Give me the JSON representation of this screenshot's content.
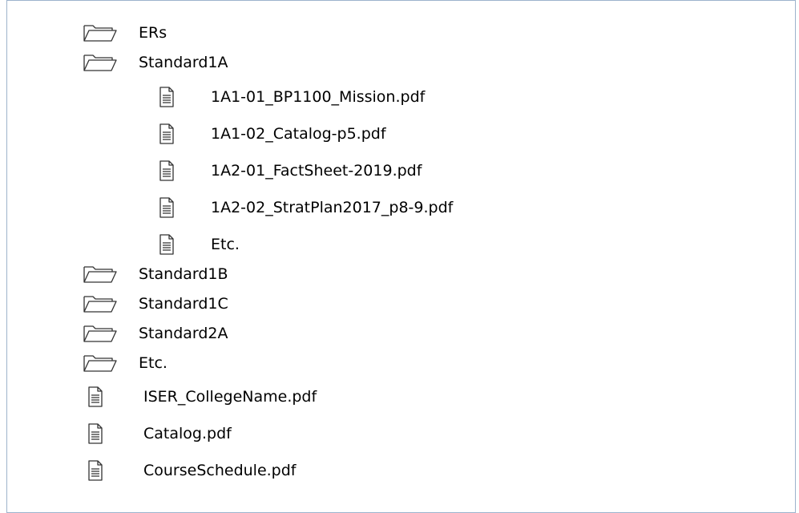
{
  "tree": {
    "items": [
      {
        "type": "folder",
        "level": 0,
        "label": "ERs",
        "icon": "folder-icon"
      },
      {
        "type": "folder",
        "level": 0,
        "label": "Standard1A",
        "icon": "folder-icon"
      },
      {
        "type": "file",
        "level": 1,
        "label": "1A1-01_BP1100_Mission.pdf",
        "icon": "document-icon"
      },
      {
        "type": "file",
        "level": 1,
        "label": "1A1-02_Catalog-p5.pdf",
        "icon": "document-icon"
      },
      {
        "type": "file",
        "level": 1,
        "label": "1A2-01_FactSheet-2019.pdf",
        "icon": "document-icon"
      },
      {
        "type": "file",
        "level": 1,
        "label": "1A2-02_StratPlan2017_p8-9.pdf",
        "icon": "document-icon"
      },
      {
        "type": "file",
        "level": 1,
        "label": "Etc.",
        "icon": "document-icon"
      },
      {
        "type": "folder",
        "level": 0,
        "label": "Standard1B",
        "icon": "folder-icon"
      },
      {
        "type": "folder",
        "level": 0,
        "label": "Standard1C",
        "icon": "folder-icon"
      },
      {
        "type": "folder",
        "level": 0,
        "label": "Standard2A",
        "icon": "folder-icon"
      },
      {
        "type": "folder",
        "level": 0,
        "label": "Etc.",
        "icon": "folder-icon"
      },
      {
        "type": "file",
        "level": 0,
        "label": "ISER_CollegeName.pdf",
        "icon": "document-icon"
      },
      {
        "type": "file",
        "level": 0,
        "label": "Catalog.pdf",
        "icon": "document-icon"
      },
      {
        "type": "file",
        "level": 0,
        "label": "CourseSchedule.pdf",
        "icon": "document-icon"
      }
    ]
  }
}
